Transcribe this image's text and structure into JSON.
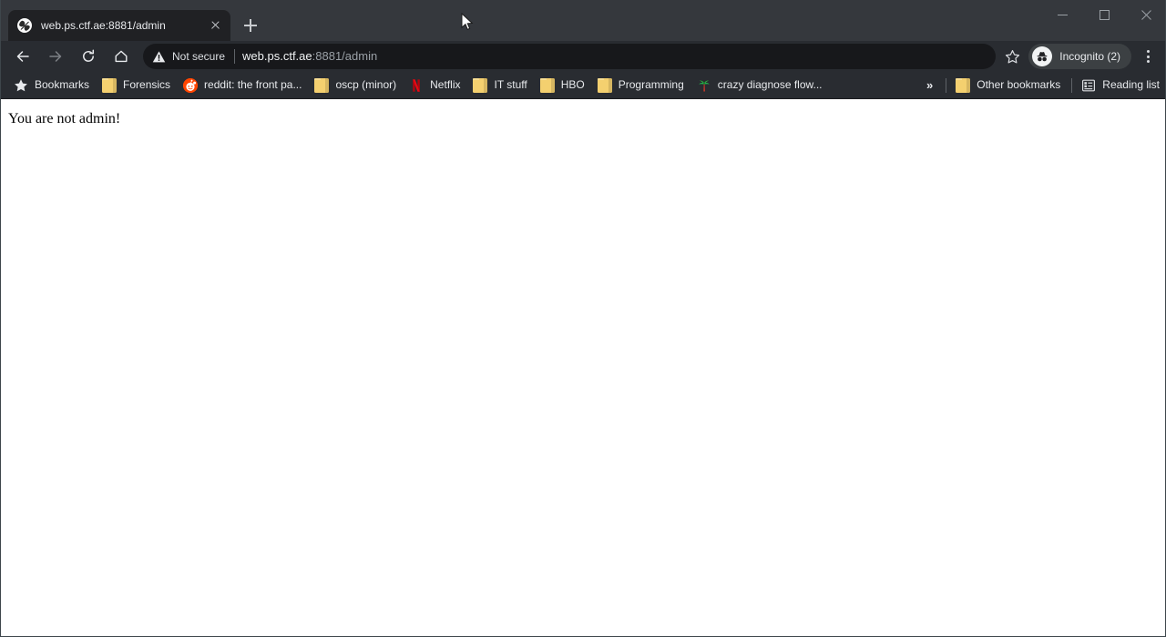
{
  "window": {
    "controls": [
      {
        "name": "minimize",
        "glyph": "minimize-icon"
      },
      {
        "name": "maximize",
        "glyph": "maximize-icon"
      },
      {
        "name": "close",
        "glyph": "close-icon"
      }
    ]
  },
  "tabstrip": {
    "tabs": [
      {
        "title": "web.ps.ctf.ae:8881/admin",
        "favicon": "globe-icon",
        "active": true
      }
    ],
    "new_tab_label": "+"
  },
  "toolbar": {
    "back_label": "Back",
    "forward_label": "Forward",
    "reload_label": "Reload",
    "home_label": "Home",
    "security": {
      "icon": "warning-triangle-icon",
      "text": "Not secure"
    },
    "url": {
      "host": "web.ps.ctf.ae",
      "rest": ":8881/admin",
      "full": "web.ps.ctf.ae:8881/admin"
    },
    "bookmark_star": "star-outline-icon",
    "profile": {
      "icon": "incognito-icon",
      "label": "Incognito (2)"
    },
    "menu": "three-dot-menu-icon"
  },
  "bookmarks_bar": {
    "items": [
      {
        "label": "Bookmarks",
        "icon": "star-icon"
      },
      {
        "label": "Forensics",
        "icon": "folder-icon"
      },
      {
        "label": "reddit: the front pa...",
        "icon": "reddit-icon"
      },
      {
        "label": "oscp (minor)",
        "icon": "folder-icon"
      },
      {
        "label": "Netflix",
        "icon": "netflix-icon"
      },
      {
        "label": "IT stuff",
        "icon": "folder-icon"
      },
      {
        "label": "HBO",
        "icon": "folder-icon"
      },
      {
        "label": "Programming",
        "icon": "folder-icon"
      },
      {
        "label": "crazy diagnose flow...",
        "icon": "palm-tree-icon"
      }
    ],
    "overflow_label": "»",
    "other_bookmarks": {
      "label": "Other bookmarks",
      "icon": "folder-icon"
    },
    "reading_list": {
      "label": "Reading list",
      "icon": "reading-list-icon"
    }
  },
  "page": {
    "body_text": "You are not admin!"
  },
  "colors": {
    "tabstrip_bg": "#35383d",
    "toolbar_bg": "#292c31",
    "active_tab_bg": "#202124",
    "omnibox_bg": "#17181b",
    "text_primary": "#e8eaed",
    "text_secondary": "#9aa0a6",
    "page_bg": "#ffffff",
    "folder_yellow": "#f4d06f",
    "reddit_orange": "#ff4500",
    "netflix_red": "#e50914"
  }
}
